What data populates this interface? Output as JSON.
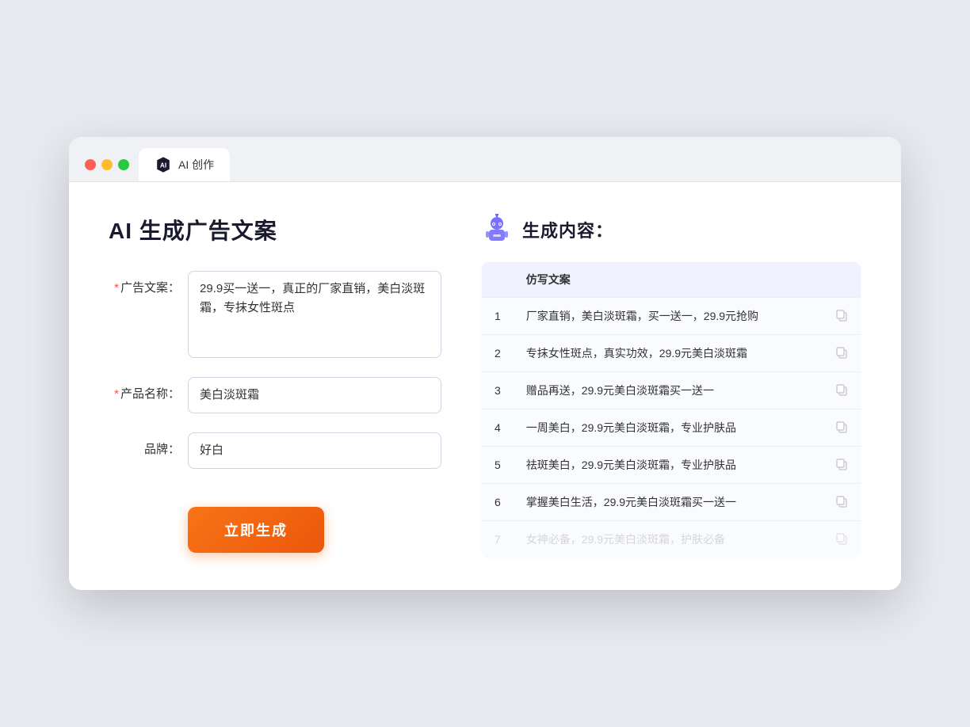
{
  "browser": {
    "tab_label": "AI 创作"
  },
  "left_panel": {
    "title": "AI 生成广告文案",
    "form": {
      "ad_label": "广告文案：",
      "ad_required": "*",
      "ad_value": "29.9买一送一，真正的厂家直销，美白淡斑霜，专抹女性斑点",
      "product_label": "产品名称：",
      "product_required": "*",
      "product_value": "美白淡斑霜",
      "brand_label": "品牌：",
      "brand_value": "好白"
    },
    "generate_btn": "立即生成"
  },
  "right_panel": {
    "title": "生成内容：",
    "table_header": "仿写文案",
    "rows": [
      {
        "num": "1",
        "text": "厂家直销，美白淡斑霜，买一送一，29.9元抢购",
        "faded": false
      },
      {
        "num": "2",
        "text": "专抹女性斑点，真实功效，29.9元美白淡斑霜",
        "faded": false
      },
      {
        "num": "3",
        "text": "赠品再送，29.9元美白淡斑霜买一送一",
        "faded": false
      },
      {
        "num": "4",
        "text": "一周美白，29.9元美白淡斑霜，专业护肤品",
        "faded": false
      },
      {
        "num": "5",
        "text": "祛斑美白，29.9元美白淡斑霜，专业护肤品",
        "faded": false
      },
      {
        "num": "6",
        "text": "掌握美白生活，29.9元美白淡斑霜买一送一",
        "faded": false
      },
      {
        "num": "7",
        "text": "女神必备，29.9元美白淡斑霜，护肤必备",
        "faded": true
      }
    ]
  }
}
